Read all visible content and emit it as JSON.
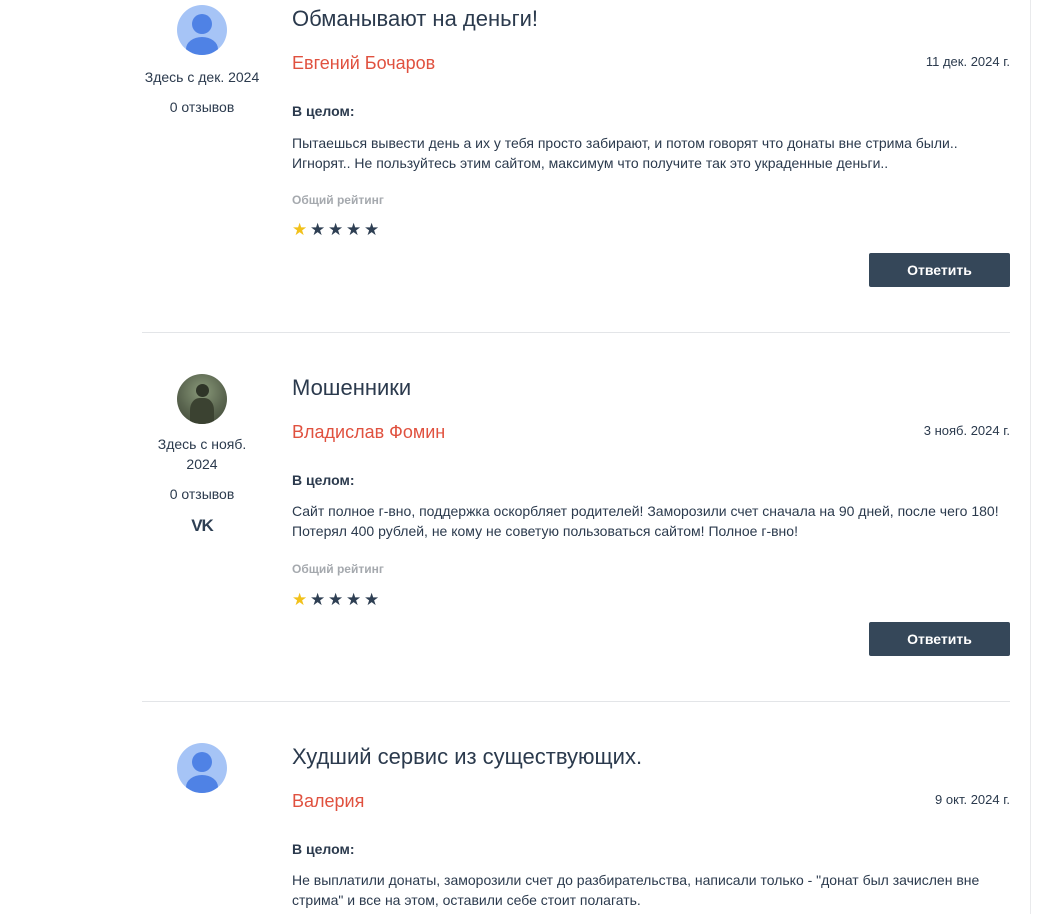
{
  "reviews": [
    {
      "title": "Обманывают на деньги!",
      "author": "Евгений Бочаров",
      "date": "11 дек. 2024 г.",
      "since": "Здесь с дек. 2024",
      "reviews_count": "0 отзывов",
      "overall_label": "В целом:",
      "text": "Пытаешься вывести день а их у тебя просто забирают, и потом говорят что донаты вне стрима были.. Игнорят.. Не пользуйтесь этим сайтом, максимум что получите так это украденные деньги..",
      "rating_label": "Общий рейтинг",
      "rating": 1,
      "rating_max": 5,
      "reply_label": "Ответить",
      "avatar": "default-user-icon"
    },
    {
      "title": "Мошенники",
      "author": "Владислав Фомин",
      "date": "3 нояб. 2024 г.",
      "since_line1": "Здесь с нояб.",
      "since_line2": "2024",
      "reviews_count": "0 отзывов",
      "social": "vk-icon",
      "social_text": "VK",
      "overall_label": "В целом:",
      "text": "Сайт полное г-вно, поддержка оскорбляет родителей! Заморозили счет сначала на 90 дней, после чего 180! Потерял 400 рублей, не кому не советую пользоваться сайтом! Полное г-вно!",
      "rating_label": "Общий рейтинг",
      "rating": 1,
      "rating_max": 5,
      "reply_label": "Ответить",
      "avatar": "user-photo"
    },
    {
      "title": "Худший сервис из существующих.",
      "author": "Валерия",
      "date": "9 окт. 2024 г.",
      "overall_label": "В целом:",
      "text": "Не выплатили донаты, заморозили счет до разбирательства, написали только - \"донат был зачислен вне стрима\" и все на этом, оставили себе стоит полагать.",
      "avatar": "default-user-icon"
    }
  ],
  "colors": {
    "accent": "#e0513f",
    "button": "#354759",
    "star_on": "#f2c11a",
    "star_off": "#2e3f53",
    "avatar_bg": "#a6c4f6",
    "avatar_fg": "#4f82e5"
  }
}
